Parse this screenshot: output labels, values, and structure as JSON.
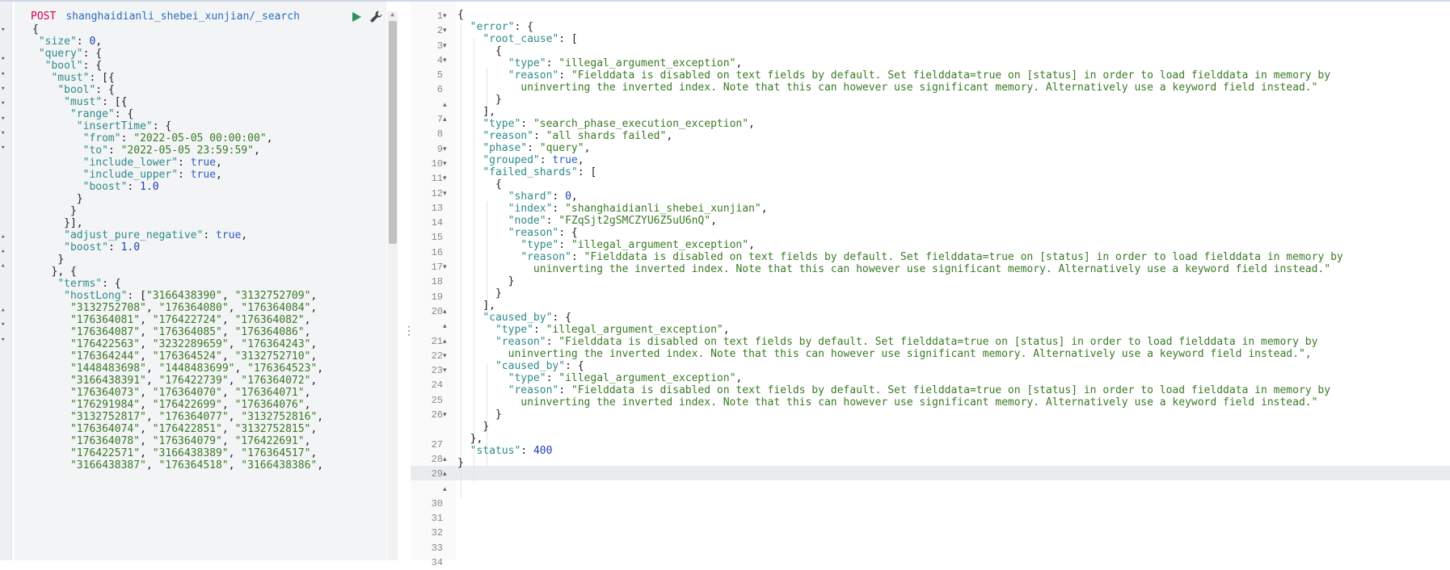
{
  "request": {
    "method": "POST",
    "path": "shanghaidianli_shebei_xunjian/_search",
    "run_icon": "play-icon",
    "settings_icon": "wrench-icon",
    "body_lines": [
      "{",
      " \"size\": 0,",
      " \"query\": {",
      "  \"bool\": {",
      "   \"must\": [{",
      "    \"bool\": {",
      "     \"must\": [{",
      "      \"range\": {",
      "       \"insertTime\": {",
      "        \"from\": \"2022-05-05 00:00:00\",",
      "        \"to\": \"2022-05-05 23:59:59\",",
      "        \"include_lower\": true,",
      "        \"include_upper\": true,",
      "        \"boost\": 1.0",
      "       }",
      "      }",
      "     }],",
      "     \"adjust_pure_negative\": true,",
      "     \"boost\": 1.0",
      "    }",
      "   }, {",
      "    \"terms\": {",
      "     \"hostLong\": [\"3166438390\", \"3132752709\",",
      "      \"3132752708\", \"176364080\", \"176364084\",",
      "      \"176364081\", \"176422724\", \"176364082\",",
      "      \"176364087\", \"176364085\", \"176364086\",",
      "      \"176422563\", \"3232289659\", \"176364243\",",
      "      \"176364244\", \"176364524\", \"3132752710\",",
      "      \"1448483698\", \"1448483699\", \"176364523\",",
      "      \"3166438391\", \"176422739\", \"176364072\",",
      "      \"176364073\", \"176364070\", \"176364071\",",
      "      \"176291984\", \"176422699\", \"176364076\",",
      "      \"3132752817\", \"176364077\", \"3132752816\",",
      "      \"176364074\", \"176422851\", \"3132752815\",",
      "      \"176364078\", \"176364079\", \"176422691\",",
      "      \"176422571\", \"3166438389\", \"176364517\",",
      "      \"3166438387\", \"176364518\", \"3166438386\","
    ]
  },
  "response": {
    "line_numbers": [
      "1",
      "2",
      "3",
      "4",
      "5",
      "6",
      "",
      "7",
      "8",
      "9",
      "10",
      "11",
      "12",
      "13",
      "14",
      "15",
      "16",
      "17",
      "18",
      "19",
      "20",
      "",
      "21",
      "22",
      "23",
      "24",
      "25",
      "26",
      "",
      "27",
      "28",
      "29",
      "",
      "30",
      "31",
      "32",
      "33",
      "34"
    ],
    "active_line": "29",
    "body_lines": [
      "{",
      "  \"error\": {",
      "    \"root_cause\": [",
      "      {",
      "        \"type\": \"illegal_argument_exception\",",
      "        \"reason\": \"Fielddata is disabled on text fields by default. Set fielddata=true on [status] in order to load fielddata in memory by",
      "          uninverting the inverted index. Note that this can however use significant memory. Alternatively use a keyword field instead.\"",
      "      }",
      "    ],",
      "    \"type\": \"search_phase_execution_exception\",",
      "    \"reason\": \"all shards failed\",",
      "    \"phase\": \"query\",",
      "    \"grouped\": true,",
      "    \"failed_shards\": [",
      "      {",
      "        \"shard\": 0,",
      "        \"index\": \"shanghaidianli_shebei_xunjian\",",
      "        \"node\": \"FZqSjt2gSMCZYU6Z5uU6nQ\",",
      "        \"reason\": {",
      "          \"type\": \"illegal_argument_exception\",",
      "          \"reason\": \"Fielddata is disabled on text fields by default. Set fielddata=true on [status] in order to load fielddata in memory by",
      "            uninverting the inverted index. Note that this can however use significant memory. Alternatively use a keyword field instead.\"",
      "        }",
      "      }",
      "    ],",
      "    \"caused_by\": {",
      "      \"type\": \"illegal_argument_exception\",",
      "      \"reason\": \"Fielddata is disabled on text fields by default. Set fielddata=true on [status] in order to load fielddata in memory by",
      "        uninverting the inverted index. Note that this can however use significant memory. Alternatively use a keyword field instead.\",",
      "      \"caused_by\": {",
      "        \"type\": \"illegal_argument_exception\",",
      "        \"reason\": \"Fielddata is disabled on text fields by default. Set fielddata=true on [status] in order to load fielddata in memory by",
      "          uninverting the inverted index. Note that this can however use significant memory. Alternatively use a keyword field instead.\"",
      "      }",
      "    }",
      "  },",
      "  \"status\": 400",
      "}"
    ]
  }
}
